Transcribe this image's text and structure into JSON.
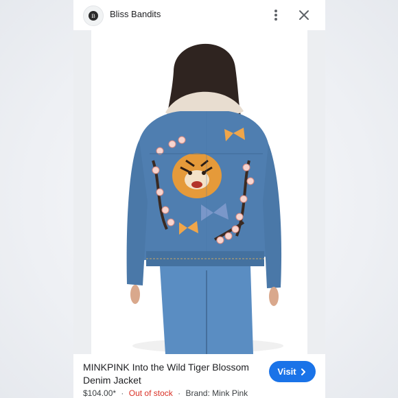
{
  "header": {
    "site_name": "Bliss Bandits",
    "logo_icon": "site-logo-icon",
    "more_icon": "more-vertical-icon",
    "close_icon": "close-icon"
  },
  "image": {
    "subject": "product-photo-denim-jacket"
  },
  "product": {
    "title": "MINKPINK Into the Wild Tiger Blossom Denim Jacket",
    "price": "$104.00*",
    "stock": "Out of stock",
    "brand": "Brand: Mink Pink",
    "separator": "·"
  },
  "actions": {
    "visit_label": "Visit",
    "visit_icon": "chevron-right-icon"
  },
  "colors": {
    "accent": "#1a73e8",
    "out_of_stock": "#d93025"
  }
}
